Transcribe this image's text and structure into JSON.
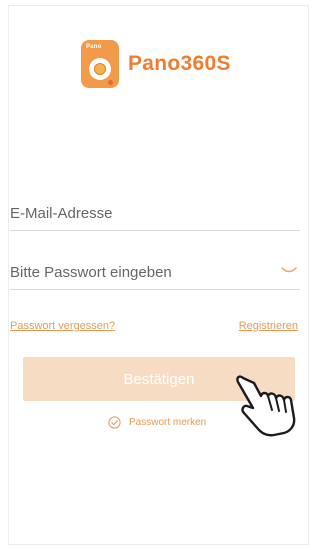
{
  "app": {
    "logo_small_text": "Pano",
    "name": "Pano360S"
  },
  "form": {
    "email_placeholder": "E-Mail-Adresse",
    "password_placeholder": "Bitte Passwort eingeben",
    "forgot_password": "Passwort vergessen?",
    "register": "Registrieren",
    "confirm_label": "Bestätigen",
    "remember_label": "Passwort merken"
  },
  "icons": {
    "app_logo": "pano-camera-logo-icon",
    "password_toggle": "eye-closed-icon",
    "remember_check": "check-circle-icon",
    "tap_hint": "pointing-hand-icon"
  },
  "colors": {
    "accent": "#ee7e2f",
    "link": "#e89a56",
    "confirm_button_bg": "#f7dcc4",
    "divider": "#d8d8d8"
  }
}
